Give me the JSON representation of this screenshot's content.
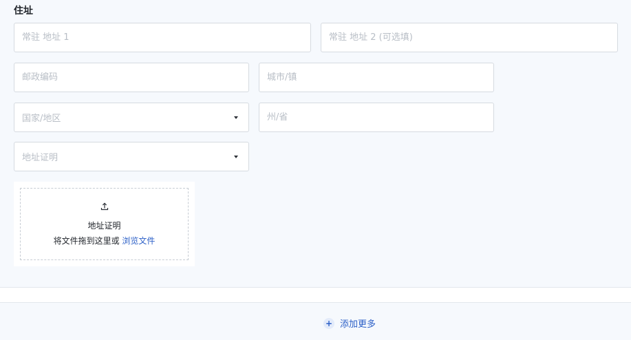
{
  "section": {
    "title": "住址"
  },
  "fields": {
    "address_line1": {
      "placeholder": "常驻 地址 1",
      "value": ""
    },
    "address_line2": {
      "placeholder": "常驻 地址 2 (可选填)",
      "value": ""
    },
    "postal_code": {
      "placeholder": "邮政编码",
      "value": ""
    },
    "city": {
      "placeholder": "城市/镇",
      "value": ""
    },
    "country": {
      "selected": "国家/地区"
    },
    "state": {
      "placeholder": "州/省",
      "value": ""
    },
    "proof_type": {
      "selected": "地址证明"
    }
  },
  "upload": {
    "icon": "upload-icon",
    "title": "地址证明",
    "hint": "将文件拖到这里或",
    "browse_label": "浏览文件"
  },
  "footer": {
    "add_more_icon": "plus-icon",
    "add_more_label": "添加更多"
  },
  "colors": {
    "accent": "#2b5fc7",
    "background": "#f6f9fd",
    "border": "#d5dae0"
  }
}
